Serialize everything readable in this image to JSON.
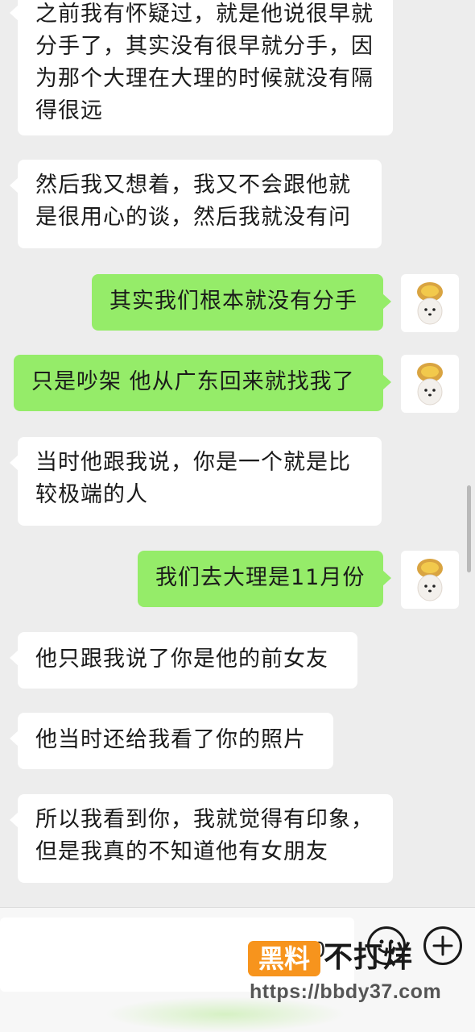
{
  "messages": [
    {
      "side": "in",
      "text": "之前我有怀疑过，就是他说很早就分手了，其实没有很早就分手，因为那个大理在大理的时候就没有隔得很远"
    },
    {
      "side": "in",
      "text": "然后我又想着，我又不会跟他就是很用心的谈，然后我就没有问"
    },
    {
      "side": "out",
      "text": "其实我们根本就没有分手"
    },
    {
      "side": "out",
      "text": "只是吵架 他从广东回来就找我了"
    },
    {
      "side": "in",
      "text": "当时他跟我说，你是一个就是比较极端的人"
    },
    {
      "side": "out",
      "text": "我们去大理是11月份"
    },
    {
      "side": "in",
      "text": "他只跟我说了你是他的前女友"
    },
    {
      "side": "in",
      "text": "他当时还给我看了你的照片"
    },
    {
      "side": "in",
      "text": "所以我看到你，我就觉得有印象，但是我真的不知道他有女朋友"
    }
  ],
  "input": {
    "partial_text": "0"
  },
  "watermark": {
    "badge": "黑料",
    "text": "不打烊",
    "url": "https://bbdy37.com"
  },
  "colors": {
    "outgoing": "#95ec69",
    "incoming": "#ffffff",
    "background": "#ededed",
    "badge": "#f7941d"
  },
  "icons": {
    "emoji": "emoji-smile-icon",
    "plus": "plus-icon",
    "avatar": "dog-avatar-icon"
  }
}
